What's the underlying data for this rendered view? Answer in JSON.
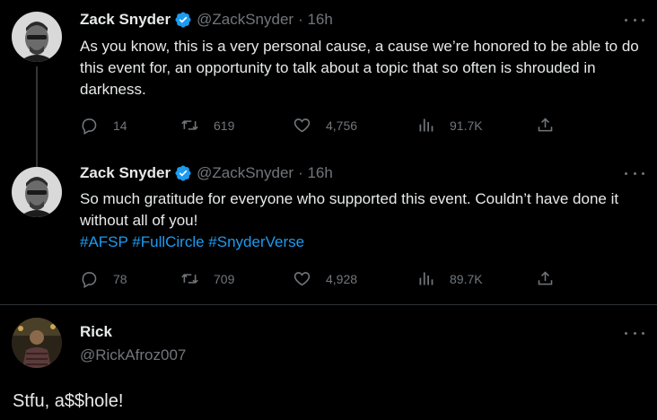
{
  "tweets": [
    {
      "name": "Zack Snyder",
      "handle": "@ZackSnyder",
      "time": "· 16h",
      "text": "As you know, this is a very personal cause, a cause we’re honored to be able to do this event for, an opportunity to talk about a topic that so often is shrouded in darkness.",
      "replies": "14",
      "retweets": "619",
      "likes": "4,756",
      "views": "91.7K"
    },
    {
      "name": "Zack Snyder",
      "handle": "@ZackSnyder",
      "time": "· 16h",
      "text": "So much gratitude for everyone who supported this event. Couldn’t have done it without all of you!",
      "hashtags": "#AFSP #FullCircle #SnyderVerse",
      "replies": "78",
      "retweets": "709",
      "likes": "4,928",
      "views": "89.7K"
    }
  ],
  "focused": {
    "name": "Rick",
    "handle": "@RickAfroz007",
    "text": "Stfu, a$$hole!"
  },
  "colors": {
    "background": "#000000",
    "text": "#e7e9ea",
    "muted": "#71767b",
    "accent": "#1d9bf0"
  }
}
